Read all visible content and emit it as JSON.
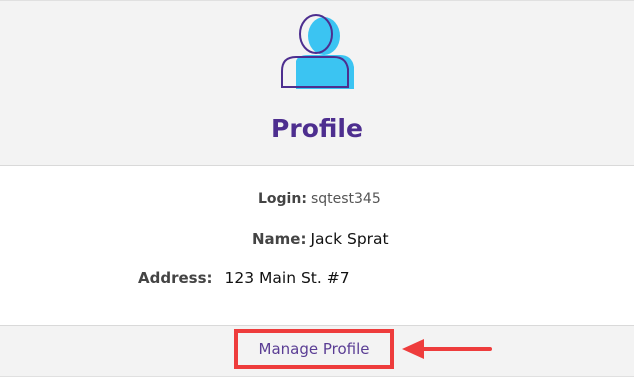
{
  "header": {
    "avatar_icon": "user-profile-icon",
    "title": "Profile"
  },
  "details": {
    "login": {
      "label": "Login:",
      "value": "sqtest345"
    },
    "name": {
      "label": "Name:",
      "value": "Jack Sprat"
    },
    "address": {
      "label": "Address:",
      "value": "123 Main St. #7"
    }
  },
  "footer": {
    "manage_label": "Manage Profile",
    "annotation_icon": "left-arrow-icon"
  },
  "colors": {
    "title": "#4d2e8f",
    "avatar_fill": "#3bc4f2",
    "avatar_outline": "#4d2e8f",
    "highlight": "#ee3c3c",
    "panel_bg": "#f3f3f3"
  }
}
